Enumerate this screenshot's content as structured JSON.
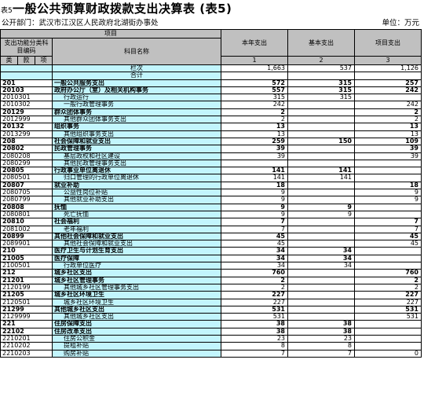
{
  "header": {
    "tag": "表5",
    "title": "一般公共预算财政拨款支出决算表 (表5)",
    "dept_label": "公开部门：武汉市江汉区人民政府北湖街办事处",
    "unit_label": "单位：万元"
  },
  "columns": {
    "project": "项目",
    "func_code": "支出功能分类科目编码",
    "subject_name": "科目名称",
    "kind": "类",
    "item": "款",
    "sub": "项",
    "current_year": "本年支出",
    "basic": "基本支出",
    "project_exp": "项目支出",
    "row_label": "栏次",
    "col1": "1",
    "col2": "2",
    "col3": "3",
    "total_label": "合计"
  },
  "totals": {
    "current": "1,663",
    "basic": "537",
    "project": "1,126"
  },
  "rows": [
    {
      "code": "201",
      "name": "一般公共服务支出",
      "v1": "572",
      "v2": "315",
      "v3": "257",
      "bold": true
    },
    {
      "code": "20103",
      "name": "政府办公厅（室）及相关机构事务",
      "v1": "557",
      "v2": "315",
      "v3": "242",
      "bold": true
    },
    {
      "code": "2010301",
      "name": "行政运行",
      "v1": "315",
      "v2": "315",
      "v3": "",
      "bold": false
    },
    {
      "code": "2010302",
      "name": "一般行政管理事务",
      "v1": "242",
      "v2": "",
      "v3": "242",
      "bold": false
    },
    {
      "code": "20129",
      "name": "群众团体事务",
      "v1": "2",
      "v2": "",
      "v3": "2",
      "bold": true
    },
    {
      "code": "2012999",
      "name": "其他群众团体事务支出",
      "v1": "2",
      "v2": "",
      "v3": "2",
      "bold": false
    },
    {
      "code": "20132",
      "name": "组织事务",
      "v1": "13",
      "v2": "",
      "v3": "13",
      "bold": true
    },
    {
      "code": "2013299",
      "name": "其他组织事务支出",
      "v1": "13",
      "v2": "",
      "v3": "13",
      "bold": false
    },
    {
      "code": "208",
      "name": "社会保障和就业支出",
      "v1": "259",
      "v2": "150",
      "v3": "109",
      "bold": true
    },
    {
      "code": "20802",
      "name": "民政管理事务",
      "v1": "39",
      "v2": "",
      "v3": "39",
      "bold": true
    },
    {
      "code": "2080208",
      "name": "基层政权和社区建设",
      "v1": "39",
      "v2": "",
      "v3": "39",
      "bold": false
    },
    {
      "code": "2080299",
      "name": "其他民政管理事务支出",
      "v1": "",
      "v2": "",
      "v3": "",
      "bold": false
    },
    {
      "code": "20805",
      "name": "行政事业单位离退休",
      "v1": "141",
      "v2": "141",
      "v3": "",
      "bold": true
    },
    {
      "code": "2080501",
      "name": "归口管理的行政单位离退休",
      "v1": "141",
      "v2": "141",
      "v3": "",
      "bold": false
    },
    {
      "code": "20807",
      "name": "就业补助",
      "v1": "18",
      "v2": "",
      "v3": "18",
      "bold": true
    },
    {
      "code": "2080705",
      "name": "公益性岗位补贴",
      "v1": "9",
      "v2": "",
      "v3": "9",
      "bold": false
    },
    {
      "code": "2080799",
      "name": "其他就业补助支出",
      "v1": "9",
      "v2": "",
      "v3": "9",
      "bold": false
    },
    {
      "code": "20808",
      "name": "抚恤",
      "v1": "9",
      "v2": "9",
      "v3": "",
      "bold": true
    },
    {
      "code": "2080801",
      "name": "死亡抚恤",
      "v1": "9",
      "v2": "9",
      "v3": "",
      "bold": false
    },
    {
      "code": "20810",
      "name": "社会福利",
      "v1": "7",
      "v2": "",
      "v3": "7",
      "bold": true
    },
    {
      "code": "2081002",
      "name": "老年福利",
      "v1": "7",
      "v2": "",
      "v3": "7",
      "bold": false
    },
    {
      "code": "20899",
      "name": "其他社会保障和就业支出",
      "v1": "45",
      "v2": "",
      "v3": "45",
      "bold": true
    },
    {
      "code": "2089901",
      "name": "其他社会保障和就业支出",
      "v1": "45",
      "v2": "",
      "v3": "45",
      "bold": false
    },
    {
      "code": "210",
      "name": "医疗卫生与计划生育支出",
      "v1": "34",
      "v2": "34",
      "v3": "",
      "bold": true
    },
    {
      "code": "21005",
      "name": "医疗保障",
      "v1": "34",
      "v2": "34",
      "v3": "",
      "bold": true
    },
    {
      "code": "2100501",
      "name": "行政单位医疗",
      "v1": "34",
      "v2": "34",
      "v3": "",
      "bold": false
    },
    {
      "code": "212",
      "name": "城乡社区支出",
      "v1": "760",
      "v2": "",
      "v3": "760",
      "bold": true
    },
    {
      "code": "21201",
      "name": "城乡社区管理事务",
      "v1": "2",
      "v2": "",
      "v3": "2",
      "bold": true
    },
    {
      "code": "2120199",
      "name": "其他城乡社区管理事务支出",
      "v1": "2",
      "v2": "",
      "v3": "2",
      "bold": false
    },
    {
      "code": "21205",
      "name": "城乡社区环境卫生",
      "v1": "227",
      "v2": "",
      "v3": "227",
      "bold": true
    },
    {
      "code": "2120501",
      "name": "城乡社区环境卫生",
      "v1": "227",
      "v2": "",
      "v3": "227",
      "bold": false
    },
    {
      "code": "21299",
      "name": "其他城乡社区支出",
      "v1": "531",
      "v2": "",
      "v3": "531",
      "bold": true
    },
    {
      "code": "2129999",
      "name": "其他城乡社区支出",
      "v1": "531",
      "v2": "",
      "v3": "531",
      "bold": false
    },
    {
      "code": "221",
      "name": "住房保障支出",
      "v1": "38",
      "v2": "38",
      "v3": "",
      "bold": true
    },
    {
      "code": "22102",
      "name": "住房改革支出",
      "v1": "38",
      "v2": "38",
      "v3": "",
      "bold": true
    },
    {
      "code": "2210201",
      "name": "住房公积金",
      "v1": "23",
      "v2": "23",
      "v3": "",
      "bold": false
    },
    {
      "code": "2210202",
      "name": "提租补贴",
      "v1": "8",
      "v2": "8",
      "v3": "",
      "bold": false
    },
    {
      "code": "2210203",
      "name": "购房补贴",
      "v1": "7",
      "v2": "7",
      "v3": "0",
      "bold": false
    }
  ]
}
